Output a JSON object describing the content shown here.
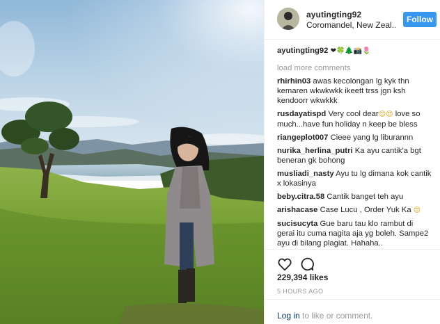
{
  "post": {
    "username": "ayutingting92",
    "location": "Coromandel, New Zeal...",
    "follow_label": "Follow",
    "caption_user": "ayutingting92",
    "caption_emojis": "❤🍀🌲📸🌷",
    "load_more": "load more comments",
    "comments": [
      {
        "user": "rhirhin03",
        "text": "awas kecolongan lg kyk thn kemaren wkwkwkk ikeett trss jgn ksh kendoorr wkwkkk"
      },
      {
        "user": "rusdayatispd",
        "text": "Very cool dear",
        "emoji": "😊😍",
        "text2": "love so much...have fun holiday n keep be bless"
      },
      {
        "user": "riangeplot007",
        "text": "Cieee yang lg liburannn"
      },
      {
        "user": "nurika_herlina_putri",
        "text": "Ka ayu cantik'a bgt beneran gk bohong"
      },
      {
        "user": "musliadi_nasty",
        "text": "Ayu tu lg dimana kok cantik x lokasinya"
      },
      {
        "user": "beby.citra.58",
        "text": "Cantik banget teh ayu"
      },
      {
        "user": "arishacase",
        "text": "Case Lucu , Order Yuk Ka",
        "emoji": "😍"
      },
      {
        "user": "sucisucyta",
        "text": "Gue baru tau klo rambut di gerai itu cuma nagita aja yg boleh. Sampe2 ayu di bilang plagiat. Hahaha.."
      }
    ],
    "likes": "229,394 likes",
    "time_ago": "5 HOURS AGO",
    "login_link": "Log in",
    "login_rest": "to like or comment.",
    "icons": {
      "like": "heart-icon",
      "comment": "comment-bubble-icon"
    },
    "colors": {
      "follow_button": "#3897f0",
      "muted_text": "#999999",
      "link": "#003569"
    }
  }
}
